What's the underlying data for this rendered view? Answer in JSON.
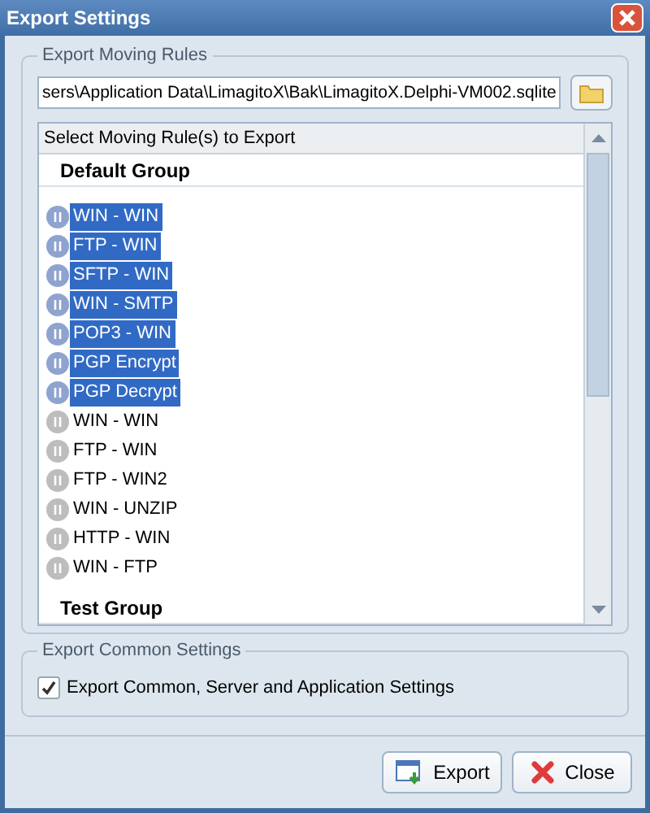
{
  "window": {
    "title": "Export Settings"
  },
  "moving_rules": {
    "legend": "Export Moving Rules",
    "path": "sers\\Application Data\\LimagitoX\\Bak\\LimagitoX.Delphi-VM002.sqlite",
    "list_header": "Select Moving Rule(s) to Export",
    "groups": [
      {
        "name": "Default Group",
        "rules": [
          {
            "label": "WIN - WIN",
            "selected": true
          },
          {
            "label": "FTP - WIN",
            "selected": true
          },
          {
            "label": "SFTP - WIN",
            "selected": true
          },
          {
            "label": "WIN - SMTP",
            "selected": true
          },
          {
            "label": "POP3 - WIN",
            "selected": true
          },
          {
            "label": "PGP Encrypt",
            "selected": true
          },
          {
            "label": "PGP Decrypt",
            "selected": true
          },
          {
            "label": "WIN - WIN",
            "selected": false
          },
          {
            "label": "FTP - WIN",
            "selected": false
          },
          {
            "label": "FTP - WIN2",
            "selected": false
          },
          {
            "label": "WIN - UNZIP",
            "selected": false
          },
          {
            "label": "HTTP - WIN",
            "selected": false
          },
          {
            "label": "WIN - FTP",
            "selected": false
          }
        ]
      },
      {
        "name": "Test Group"
      }
    ]
  },
  "common": {
    "legend": "Export Common Settings",
    "option": {
      "label": "Export Common, Server and Application Settings",
      "checked": true
    }
  },
  "buttons": [
    {
      "label": "Export",
      "kind": "export"
    },
    {
      "label": "Close",
      "kind": "close"
    }
  ]
}
